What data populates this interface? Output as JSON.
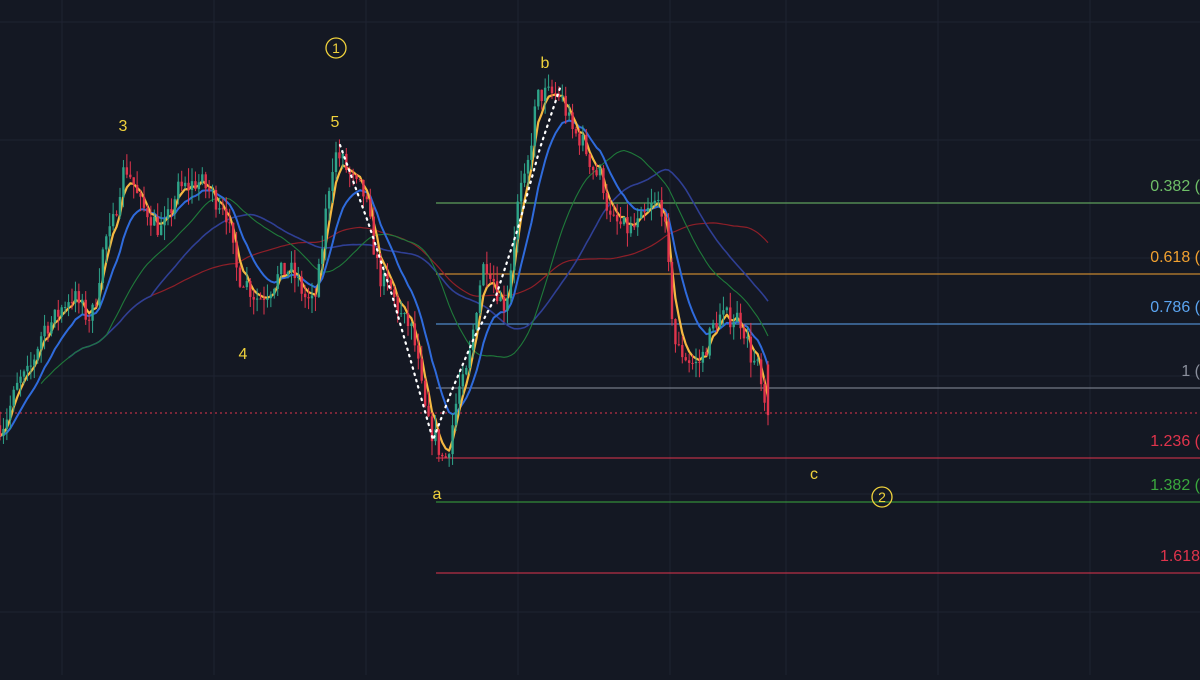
{
  "colors": {
    "background": "#141823",
    "grid": "#1e2331",
    "candle_up": "#2ea389",
    "candle_down": "#e0344c",
    "ma_fast": "#f5b942",
    "ma_mid": "#2f6bdc",
    "ma_slow_green": "#1f7a3a",
    "ma_slow_red": "#8e1f28",
    "ma_slow_navy": "#2f3f94",
    "wave_label": "#f0d23c",
    "current_price": "#e0344c",
    "dotted_path": "#ffffff"
  },
  "chart_data": {
    "type": "candlestick",
    "x_range": [
      0,
      100
    ],
    "y_range": [
      0,
      100
    ],
    "candle_count": 225,
    "key_points": [
      {
        "x": 0,
        "y": 37
      },
      {
        "x": 2,
        "y": 44
      },
      {
        "x": 4,
        "y": 52
      },
      {
        "x": 6,
        "y": 56
      },
      {
        "x": 7.5,
        "y": 53
      },
      {
        "x": 9,
        "y": 65
      },
      {
        "x": 10.5,
        "y": 75
      },
      {
        "x": 12,
        "y": 69
      },
      {
        "x": 13.5,
        "y": 66
      },
      {
        "x": 15,
        "y": 72
      },
      {
        "x": 16.5,
        "y": 73
      },
      {
        "x": 18.5,
        "y": 70
      },
      {
        "x": 20,
        "y": 59
      },
      {
        "x": 21.5,
        "y": 56
      },
      {
        "x": 24,
        "y": 60
      },
      {
        "x": 26,
        "y": 55
      },
      {
        "x": 28,
        "y": 77
      },
      {
        "x": 30,
        "y": 72
      },
      {
        "x": 32,
        "y": 58
      },
      {
        "x": 34,
        "y": 52
      },
      {
        "x": 36,
        "y": 36
      },
      {
        "x": 37,
        "y": 32
      },
      {
        "x": 38.5,
        "y": 43
      },
      {
        "x": 40.5,
        "y": 61
      },
      {
        "x": 42,
        "y": 55
      },
      {
        "x": 43.5,
        "y": 72
      },
      {
        "x": 45,
        "y": 86
      },
      {
        "x": 46.5,
        "y": 86
      },
      {
        "x": 48,
        "y": 80
      },
      {
        "x": 50,
        "y": 74
      },
      {
        "x": 51,
        "y": 67
      },
      {
        "x": 52.5,
        "y": 66
      },
      {
        "x": 55,
        "y": 70
      },
      {
        "x": 56.5,
        "y": 48
      },
      {
        "x": 58,
        "y": 46
      },
      {
        "x": 60,
        "y": 53
      },
      {
        "x": 61.5,
        "y": 53
      },
      {
        "x": 63,
        "y": 46
      },
      {
        "x": 64,
        "y": 37
      }
    ],
    "horizontal_levels": [
      {
        "label": "0.382 (",
        "value": 0.382,
        "color": "#6fbf68"
      },
      {
        "label": "0.618 (",
        "value": 0.618,
        "color": "#f0a030"
      },
      {
        "label": "0.786 (",
        "value": 0.786,
        "color": "#5ba4f0"
      },
      {
        "label": "1 (",
        "value": 1.0,
        "color": "#8a8f9c"
      },
      {
        "label": "1.236 (",
        "value": 1.236,
        "color": "#e0344c"
      },
      {
        "label": "1.382 (",
        "value": 1.382,
        "color": "#3aa83e"
      },
      {
        "label": "1.618",
        "value": 1.618,
        "color": "#e0344c"
      }
    ],
    "wave_labels": [
      {
        "text": "3"
      },
      {
        "text": "4"
      },
      {
        "text": "5"
      },
      {
        "text": "1",
        "circled": true
      },
      {
        "text": "a"
      },
      {
        "text": "b"
      },
      {
        "text": "c"
      },
      {
        "text": "2",
        "circled": true
      }
    ]
  }
}
